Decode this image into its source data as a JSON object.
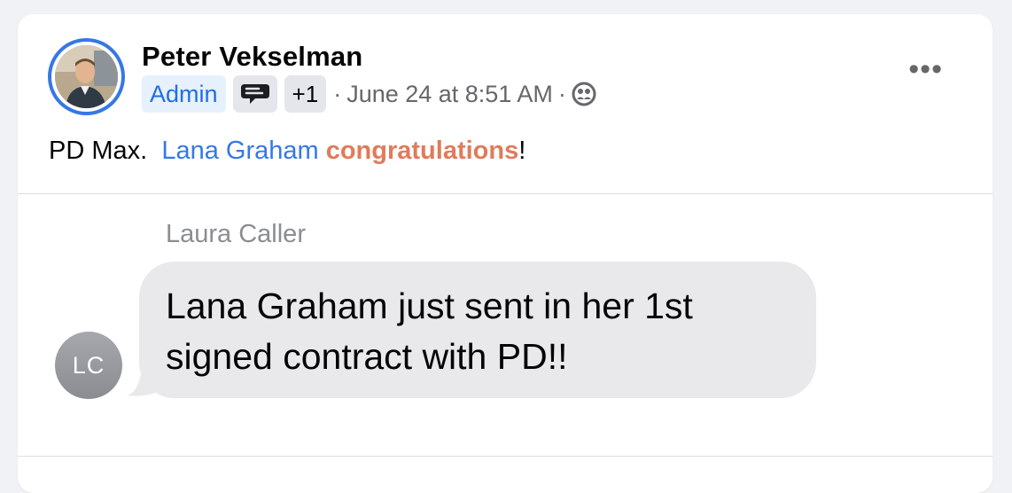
{
  "post": {
    "author": "Peter Vekselman",
    "badges": {
      "role": "Admin",
      "extra_count": "+1"
    },
    "timestamp": "June 24 at 8:51 AM",
    "separator": "·",
    "audience_icon": "group-icon",
    "more_icon": "more-options-icon",
    "more_label": "•••",
    "text_prefix": "PD Max.",
    "mention": "Lana Graham",
    "highlight": "congratulations",
    "text_suffix": "!"
  },
  "message": {
    "sender": "Laura Caller",
    "sender_initials": "LC",
    "body": "Lana Graham just sent in her 1st signed contract with PD!!"
  },
  "colors": {
    "accent": "#3578e5",
    "highlight": "#e07b5c",
    "bubble": "#e9e9eb",
    "background": "#f0f2f5"
  }
}
